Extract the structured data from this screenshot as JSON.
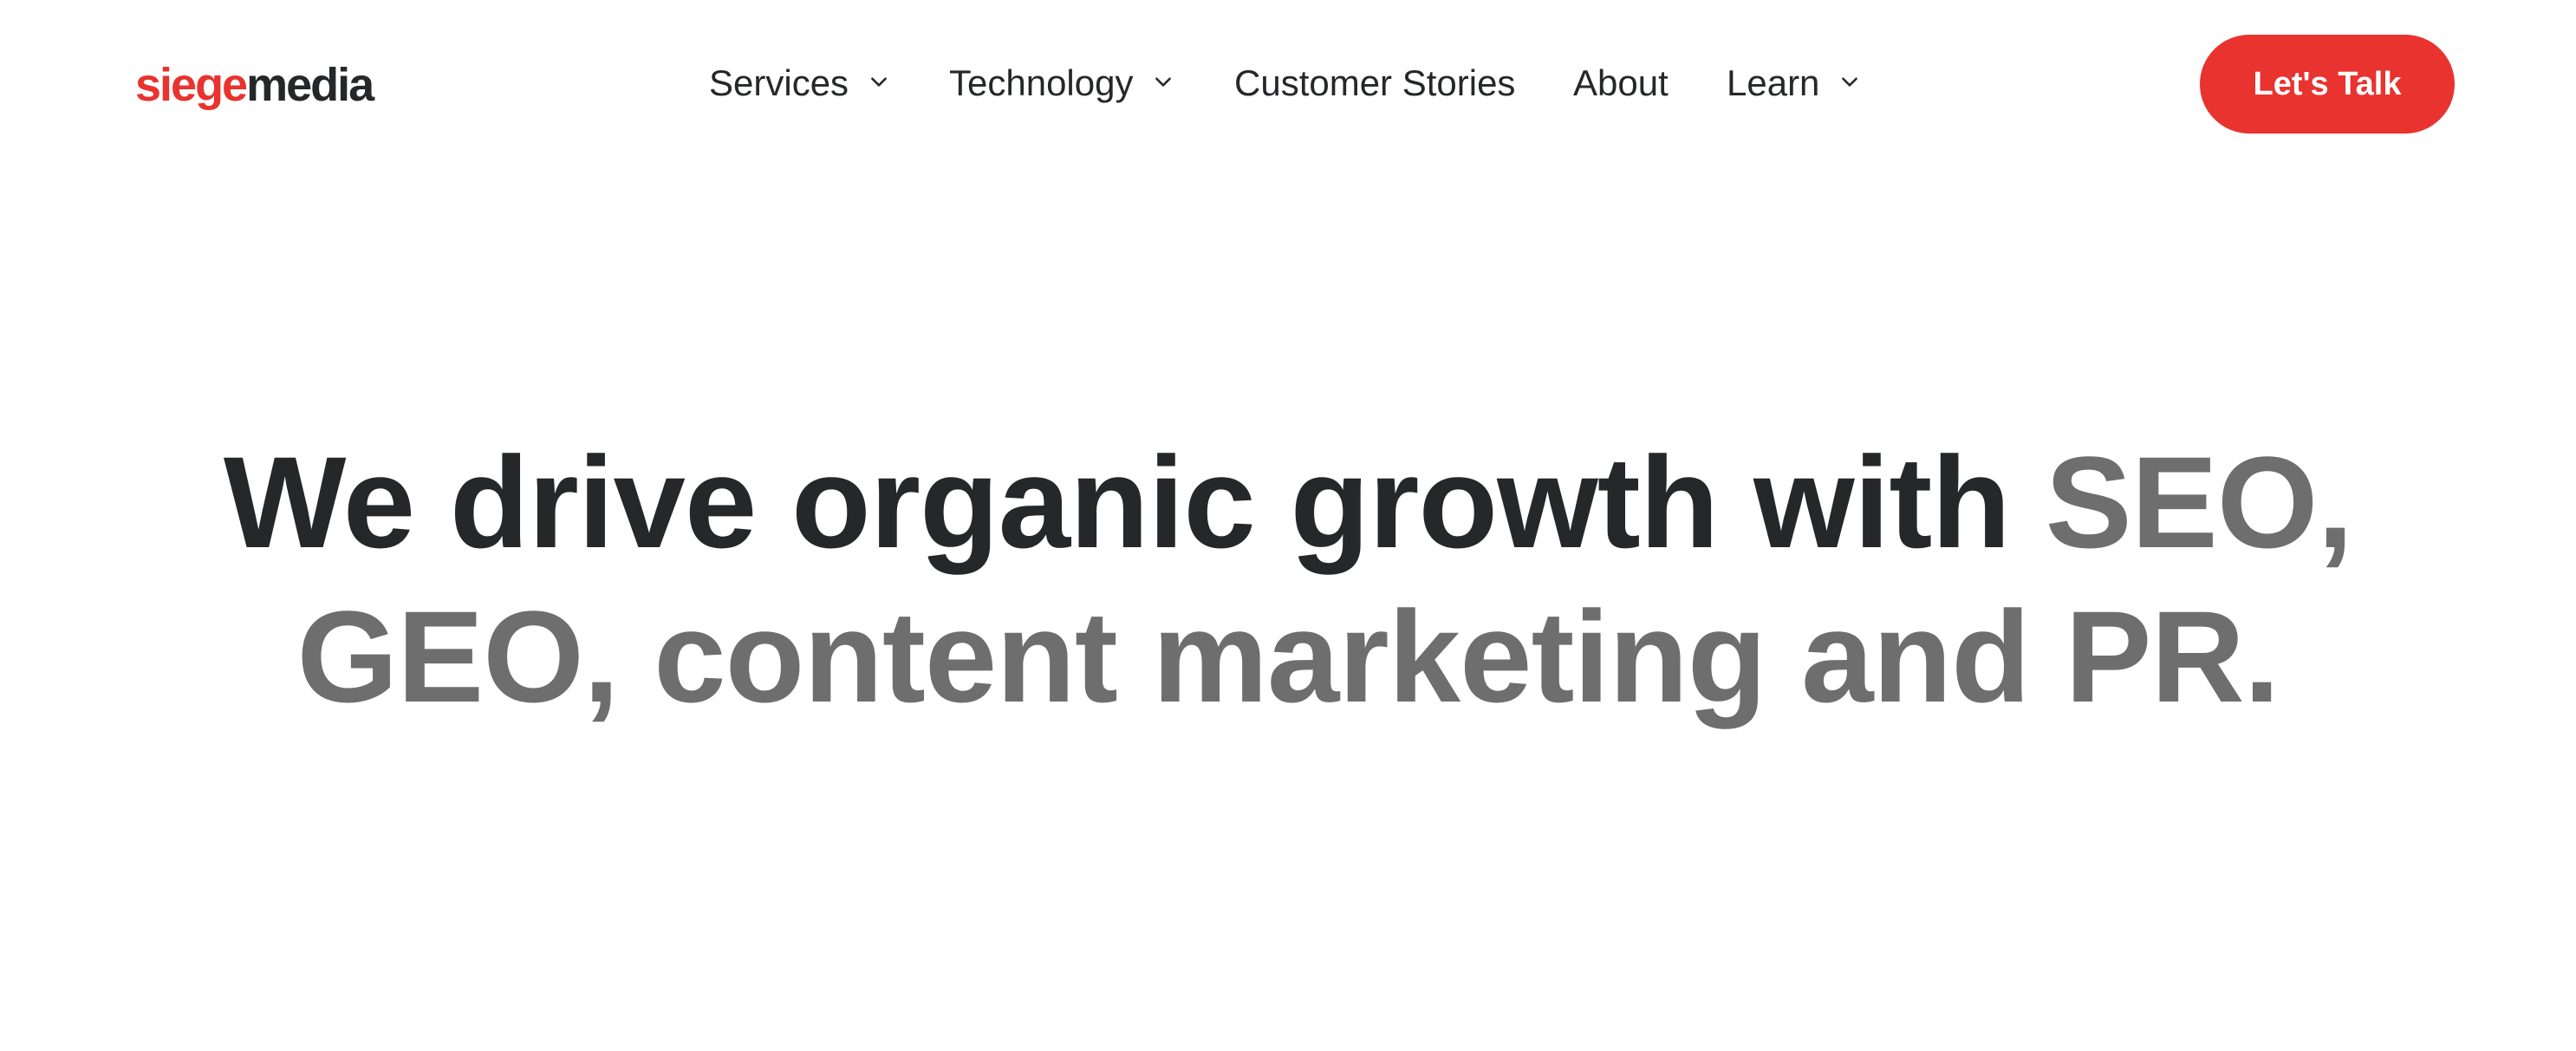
{
  "logo": {
    "part1": "siege",
    "part2": "media"
  },
  "nav": {
    "items": [
      {
        "label": "Services",
        "has_dropdown": true
      },
      {
        "label": "Technology",
        "has_dropdown": true
      },
      {
        "label": "Customer Stories",
        "has_dropdown": false
      },
      {
        "label": "About",
        "has_dropdown": false
      },
      {
        "label": "Learn",
        "has_dropdown": true
      }
    ]
  },
  "cta": {
    "label": "Let's Talk"
  },
  "hero": {
    "line1_dark": "We drive organic growth with",
    "line1_grey": "SEO,",
    "line2_grey": "GEO, content marketing and PR."
  },
  "colors": {
    "brand_red": "#e8332f",
    "text_dark": "#262729",
    "text_grey": "#6e6e6e",
    "background": "#ffffff"
  },
  "icons": {
    "dropdown": "chevron-down-icon"
  }
}
